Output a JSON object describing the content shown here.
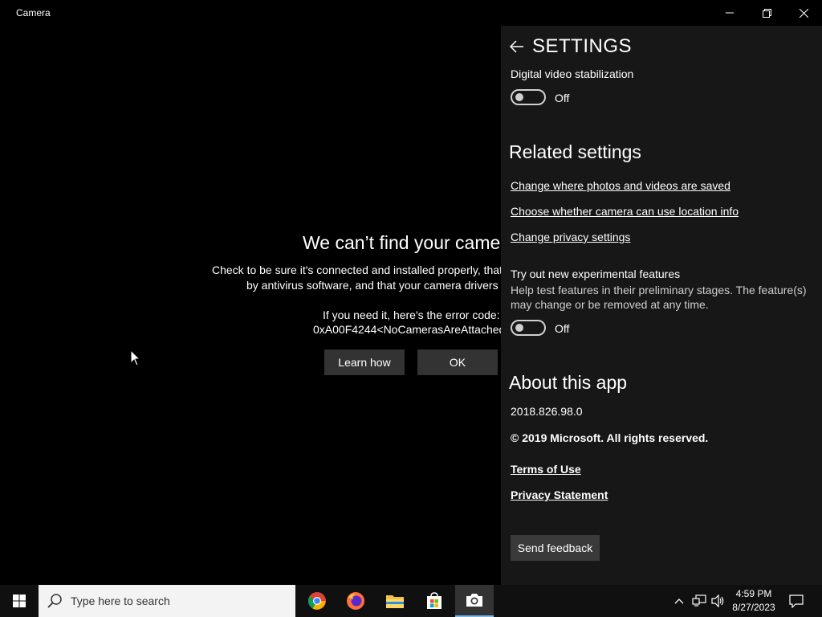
{
  "window": {
    "title": "Camera"
  },
  "error": {
    "title": "We can’t find your came",
    "line1": "Check to be sure it's connected and installed properly, that",
    "line2": "by antivirus software, and that your camera drivers",
    "code_label": "If you need it, here's the error code:",
    "code_value": "0xA00F4244<NoCamerasAreAttached",
    "learn_how": "Learn how",
    "ok": "OK"
  },
  "settings": {
    "title": "SETTINGS",
    "stabilization": {
      "label": "Digital video stabilization",
      "state": "Off"
    },
    "related_heading": "Related settings",
    "links": [
      "Change where photos and videos are saved",
      "Choose whether camera can use location info",
      "Change privacy settings"
    ],
    "experimental": {
      "label": "Try out new experimental features",
      "description": "Help test features in their preliminary stages. The feature(s) may change or be removed at any time.",
      "state": "Off"
    },
    "about_heading": "About this app",
    "version": "2018.826.98.0",
    "copyright": "© 2019 Microsoft. All rights reserved.",
    "terms": "Terms of Use",
    "privacy": "Privacy Statement",
    "feedback": "Send feedback"
  },
  "taskbar": {
    "search_placeholder": "Type here to search",
    "time": "4:59 PM",
    "date": "8/27/2023",
    "apps": [
      "chrome-icon",
      "firefox-icon",
      "file-explorer-icon",
      "store-icon",
      "camera-icon"
    ]
  },
  "colors": {
    "accent": "#76b9ed",
    "pane": "#171717",
    "button": "#333333"
  }
}
